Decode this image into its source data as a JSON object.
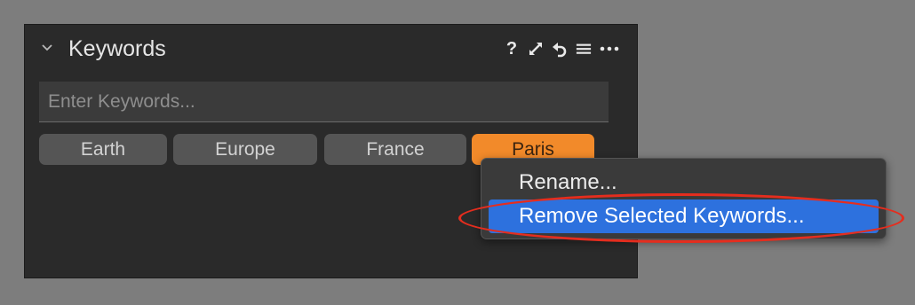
{
  "panel": {
    "title": "Keywords",
    "header_icons": [
      "chevron-down-icon",
      "help-icon",
      "expand-icon",
      "reset-icon",
      "menu-icon",
      "more-icon"
    ],
    "help_label": "?"
  },
  "search": {
    "placeholder": "Enter Keywords...",
    "value": ""
  },
  "tags": [
    {
      "label": "Earth",
      "selected": false
    },
    {
      "label": "Europe",
      "selected": false
    },
    {
      "label": "France",
      "selected": false
    },
    {
      "label": "Paris",
      "selected": true
    }
  ],
  "context_menu": {
    "items": [
      {
        "label": "Rename...",
        "highlighted": false
      },
      {
        "label": "Remove Selected Keywords...",
        "highlighted": true
      }
    ]
  },
  "colors": {
    "background": "#7d7d7d",
    "panel": "#2a2a2a",
    "tag": "#555555",
    "tag_selected": "#f28a2a",
    "menu_highlight": "#2d71de",
    "annotation": "#e52d1e"
  }
}
